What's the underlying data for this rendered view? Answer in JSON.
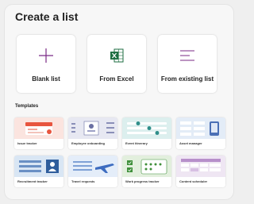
{
  "header": {
    "title": "Create a list"
  },
  "create_options": [
    {
      "label": "Blank list",
      "icon": "plus-icon"
    },
    {
      "label": "From Excel",
      "icon": "excel-icon"
    },
    {
      "label": "From existing list",
      "icon": "list-lines-icon"
    }
  ],
  "templates": {
    "title": "Templates",
    "items": [
      {
        "label": "Issue tracker",
        "icon": "issue-tracker-thumbnail"
      },
      {
        "label": "Employee onboarding",
        "icon": "employee-onboarding-thumbnail"
      },
      {
        "label": "Event itinerary",
        "icon": "event-itinerary-thumbnail"
      },
      {
        "label": "Asset manager",
        "icon": "asset-manager-thumbnail"
      },
      {
        "label": "Recruitment tracker",
        "icon": "recruitment-tracker-thumbnail"
      },
      {
        "label": "Travel requests",
        "icon": "travel-requests-thumbnail"
      },
      {
        "label": "Work progress tracker",
        "icon": "work-progress-thumbnail"
      },
      {
        "label": "Content scheduler",
        "icon": "content-scheduler-thumbnail"
      }
    ]
  },
  "colors": {
    "accent_purple": "#7a2a86",
    "excel_green": "#1e6e42"
  }
}
